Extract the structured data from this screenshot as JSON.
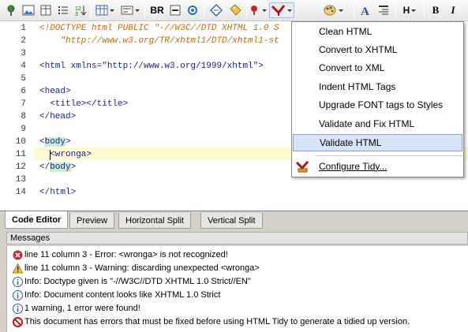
{
  "toolbar": {
    "br_label": "BR",
    "bold_label": "B",
    "italic_label": "I",
    "heading_label": "H",
    "icons": [
      "anchor-icon",
      "image-icon",
      "table-insert-icon",
      "list-icon",
      "sort-icon",
      "table-icon",
      "form-icon",
      "br-icon",
      "target-icon",
      "diamond-icon",
      "tag-icon",
      "bulb-icon",
      "tidy-icon",
      "palette-icon",
      "font-icon",
      "align-icon",
      "heading-icon",
      "bold-icon",
      "italic-icon"
    ]
  },
  "editor": {
    "line_numbers": [
      "1",
      "2",
      "3",
      "4",
      "5",
      "6",
      "7",
      "8",
      "9",
      "10",
      "11",
      "12",
      "13",
      "14"
    ],
    "lines": {
      "l1_doctype": "<!DOCTYPE html PUBLIC \"-//W3C//DTD XHTML 1.0 S",
      "l2_doctype": "    \"http://www.w3.org/TR/xhtml1/DTD/xhtml1-st",
      "l4_open": "<html ",
      "l4_attr": "xmlns=",
      "l4_str": "\"http://www.w3.org/1999/xhtml\"",
      "l4_close": ">",
      "l6": "<head>",
      "l7": "  <title></title>",
      "l8": "</head>",
      "l10_lt": "<",
      "l10_tag": "body",
      "l10_gt": ">",
      "l11_indent": "  ",
      "l11": "<wronga>",
      "l12_lt": "</",
      "l12_tag": "body",
      "l12_gt": ">",
      "l14": "</html>"
    }
  },
  "tabs": [
    "Code Editor",
    "Preview",
    "Horizontal Split",
    "Vertical Split"
  ],
  "messages": {
    "header": "Messages",
    "items": [
      {
        "icon": "error-icon",
        "text": "line 11 column 3 - Error: <wronga> is not recognized!"
      },
      {
        "icon": "warning-icon",
        "text": "line 11 column 3 - Warning: discarding unexpected <wronga>"
      },
      {
        "icon": "info-icon",
        "text": "Info: Doctype given is \"-//W3C//DTD XHTML 1.0 Strict//EN\""
      },
      {
        "icon": "info-icon",
        "text": "Info: Document content looks like XHTML 1.0 Strict"
      },
      {
        "icon": "info-icon",
        "text": "1 warning, 1 error were found!"
      },
      {
        "icon": "stop-icon",
        "text": "This document has errors that must be fixed before using HTML Tidy to generate a tidied up version."
      }
    ]
  },
  "menu": {
    "items": [
      "Clean HTML",
      "Convert to XHTML",
      "Convert to XML",
      "Indent HTML Tags",
      "Upgrade FONT tags to Styles",
      "Validate and Fix HTML",
      "Validate HTML"
    ],
    "highlighted": "Validate HTML",
    "configure": "Configure Tidy..."
  }
}
